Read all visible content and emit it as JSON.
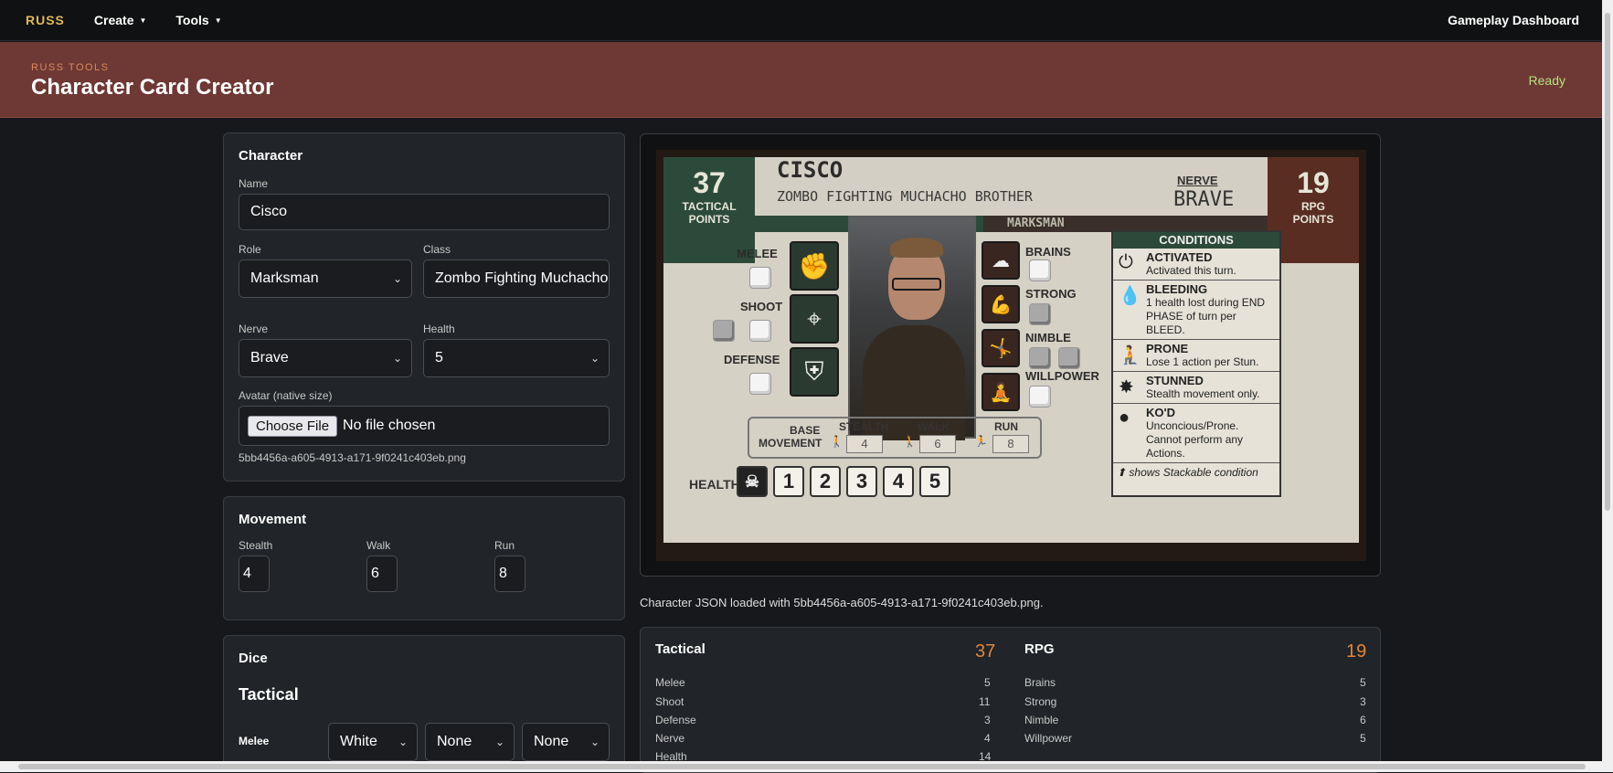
{
  "nav": {
    "brand": "RUSS",
    "create": "Create",
    "tools": "Tools",
    "dashboard": "Gameplay Dashboard"
  },
  "header": {
    "kicker": "RUSS TOOLS",
    "title": "Character Card Creator",
    "status": "Ready"
  },
  "character": {
    "heading": "Character",
    "name_label": "Name",
    "name_value": "Cisco",
    "role_label": "Role",
    "role_value": "Marksman",
    "class_label": "Class",
    "class_value": "Zombo Fighting Muchacho Brother",
    "nerve_label": "Nerve",
    "nerve_value": "Brave",
    "health_label": "Health",
    "health_value": "5",
    "avatar_label": "Avatar (native size)",
    "file_button": "Choose File",
    "file_status": "No file chosen",
    "file_name": "5bb4456a-a605-4913-a171-9f0241c403eb.png"
  },
  "movement": {
    "heading": "Movement",
    "stealth_label": "Stealth",
    "stealth_value": "4",
    "walk_label": "Walk",
    "walk_value": "6",
    "run_label": "Run",
    "run_value": "8"
  },
  "dice": {
    "heading": "Dice",
    "sub": "Tactical",
    "melee_label": "Melee",
    "melee_1": "White",
    "melee_2": "None",
    "melee_3": "None"
  },
  "card": {
    "tactical_points": "37",
    "tactical_caption_1": "TACTICAL",
    "tactical_caption_2": "POINTS",
    "rpg_points": "19",
    "rpg_caption_1": "RPG",
    "rpg_caption_2": "POINTS",
    "name": "CISCO",
    "class": "ZOMBO FIGHTING MUCHACHO BROTHER",
    "nerve_caption": "NERVE",
    "nerve": "BRAVE",
    "role": "MARKSMAN",
    "melee": "MELEE",
    "shoot": "SHOOT",
    "defense": "DEFENSE",
    "brains": "BRAINS",
    "strong": "STRONG",
    "nimble": "NIMBLE",
    "willpower": "WILLPOWER",
    "base_movement_1": "BASE",
    "base_movement_2": "MOVEMENT",
    "stealth": "STEALTH",
    "walk": "WALK",
    "run": "RUN",
    "stealth_val": "4",
    "walk_val": "6",
    "run_val": "8",
    "health": "HEALTH",
    "health_boxes": [
      "1",
      "2",
      "3",
      "4",
      "5"
    ],
    "conditions_head": "CONDITIONS",
    "conditions": [
      {
        "title": "ACTIVATED",
        "desc": "Activated this turn.",
        "icon": "power-icon"
      },
      {
        "title": "BLEEDING",
        "desc": "1 health lost during END PHASE of turn per BLEED.",
        "icon": "blood-drop-icon"
      },
      {
        "title": "PRONE",
        "desc": "Lose 1 action per Stun.",
        "icon": "prone-icon"
      },
      {
        "title": "STUNNED",
        "desc": "Stealth movement only.",
        "icon": "stunned-icon"
      },
      {
        "title": "KO'D",
        "desc": "Unconcious/Prone. Cannot perform any Actions.",
        "icon": "ko-icon"
      }
    ],
    "conditions_foot": "shows Stackable condition"
  },
  "json_msg": "Character JSON loaded with 5bb4456a-a605-4913-a171-9f0241c403eb.png.",
  "summary": {
    "tactical_head": "Tactical",
    "tactical_total": "37",
    "rpg_head": "RPG",
    "rpg_total": "19",
    "tactical_rows": [
      {
        "label": "Melee",
        "value": "5"
      },
      {
        "label": "Shoot",
        "value": "11"
      },
      {
        "label": "Defense",
        "value": "3"
      },
      {
        "label": "Nerve",
        "value": "4"
      },
      {
        "label": "Health",
        "value": "14"
      }
    ],
    "rpg_rows": [
      {
        "label": "Brains",
        "value": "5"
      },
      {
        "label": "Strong",
        "value": "3"
      },
      {
        "label": "Nimble",
        "value": "6"
      },
      {
        "label": "Willpower",
        "value": "5"
      }
    ]
  },
  "colors": {
    "brand": "#e2b65a",
    "header_bg": "#6e3834",
    "status": "#b7e07c",
    "accent_total": "#e0873a",
    "tactical_green": "#2c4a3a",
    "rpg_brown": "#5a2d22"
  }
}
